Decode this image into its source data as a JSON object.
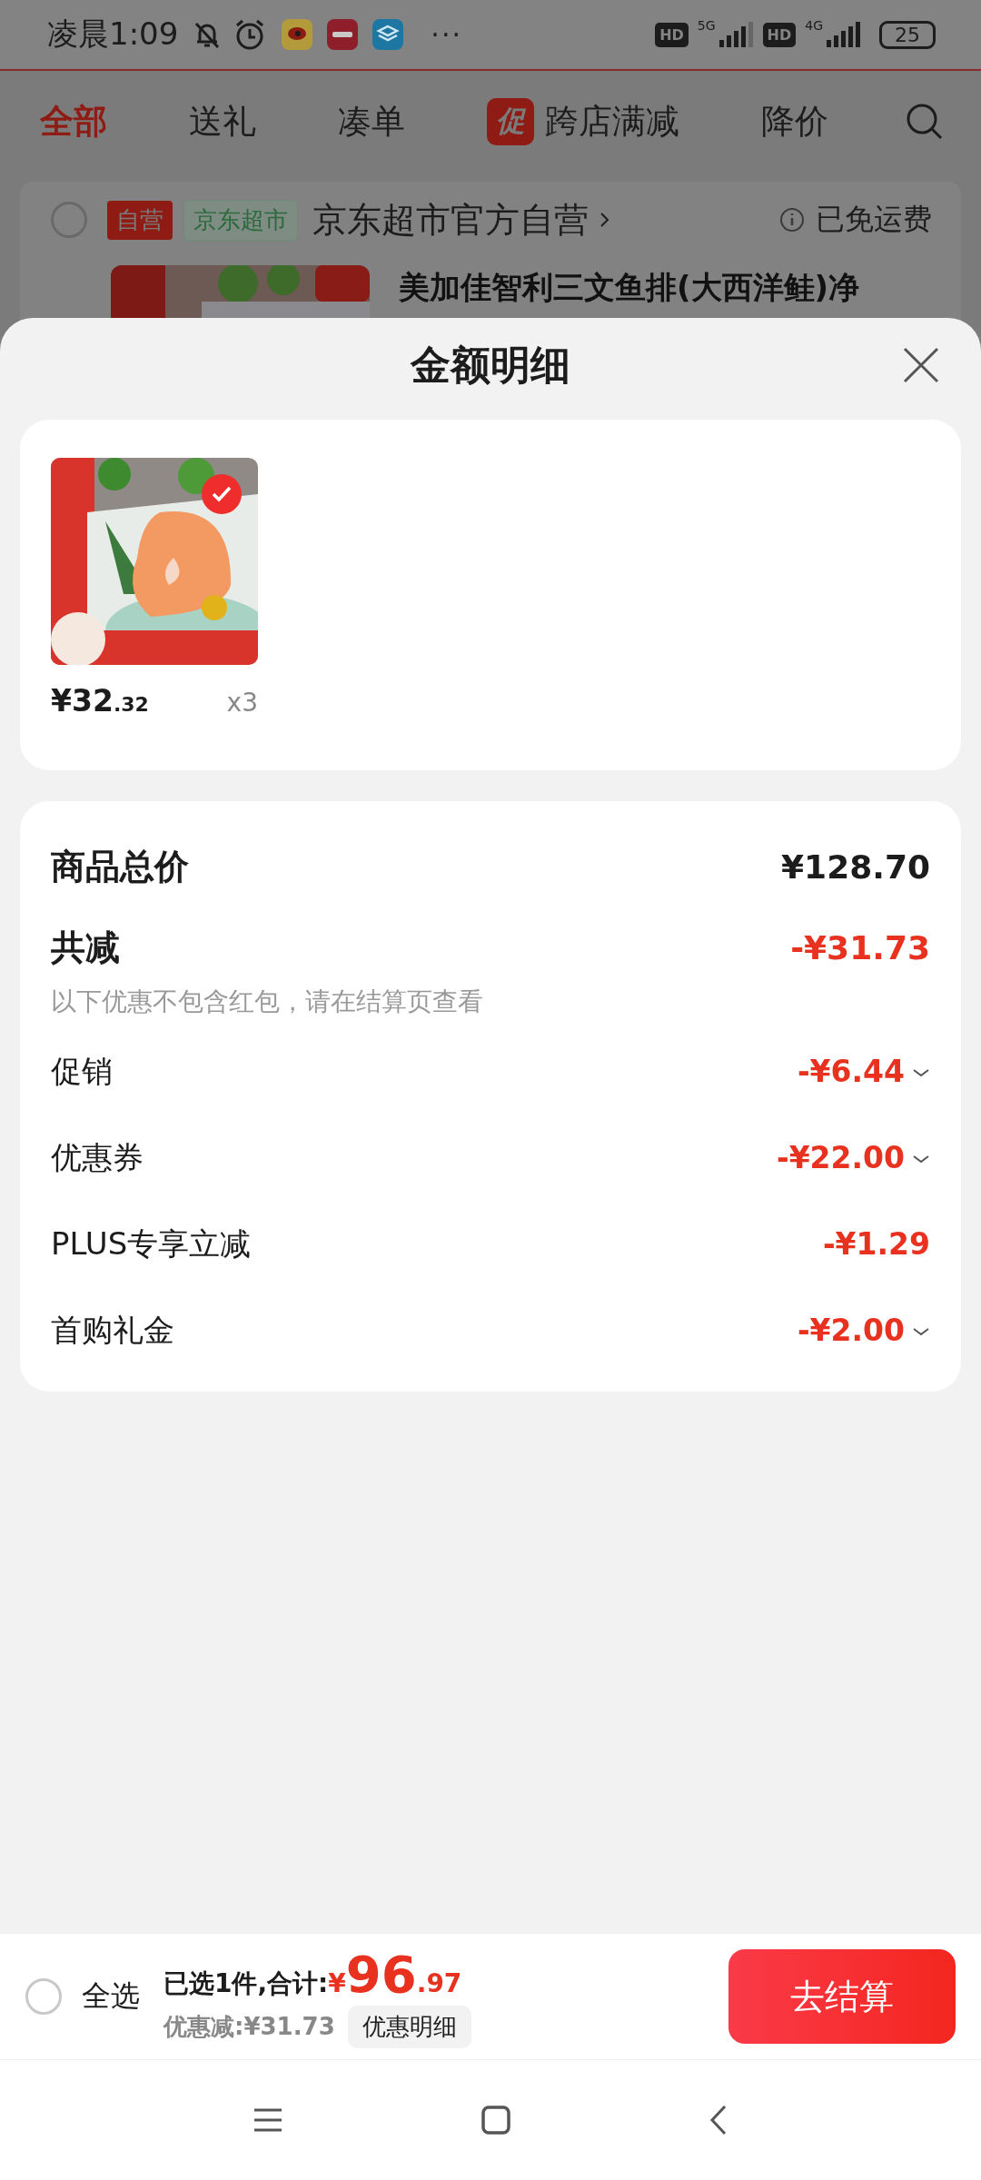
{
  "status_bar": {
    "time": "凌晨1:09",
    "more": "···",
    "hd_1": "HD",
    "network_1": "5G",
    "hd_2": "HD",
    "network_2": "4G",
    "battery": "25"
  },
  "tabs": [
    {
      "label": "全部",
      "selected": true
    },
    {
      "label": "送礼",
      "selected": false
    },
    {
      "label": "凑单",
      "selected": false
    },
    {
      "label": "跨店满减",
      "selected": false,
      "badge": "促"
    },
    {
      "label": "降价",
      "selected": false
    }
  ],
  "store": {
    "checked": false,
    "tags": [
      {
        "text": "自营",
        "kind": "self"
      },
      {
        "text": "京东超市",
        "kind": "market"
      }
    ],
    "name": "京东超市官方自营",
    "shipping": "已免运费"
  },
  "product_title": "美加佳智利三文鱼排(大西洋鲑)净",
  "sheet": {
    "title": "金额明细",
    "items": [
      {
        "kind": "picture",
        "selected": true,
        "price_symbol": "¥",
        "price_main": "32",
        "price_decimal": ".32",
        "quantity": "x3"
      }
    ],
    "summary": {
      "total_label": "商品总价",
      "total": "¥128.70",
      "discount_label": "共减",
      "discount": "-¥31.73",
      "note": "以下优惠不包含红包，请在结算页查看",
      "rows": [
        {
          "label": "促销",
          "amount": "-¥6.44",
          "expandable": true
        },
        {
          "label": "优惠券",
          "amount": "-¥22.00",
          "expandable": true
        },
        {
          "label": "PLUS专享立减",
          "amount": "-¥1.29",
          "expandable": false
        },
        {
          "label": "首购礼金",
          "amount": "-¥2.00",
          "expandable": true
        }
      ]
    }
  },
  "bottom_bar": {
    "select_all": {
      "label": "全选",
      "checked": false
    },
    "selected_text": "已选1件,合计:",
    "total_symbol": "¥",
    "total_main": "96",
    "total_decimal": ".97",
    "discount_note": "优惠减:¥31.73",
    "detail_button": "优惠明细",
    "checkout_button": "去结算"
  }
}
